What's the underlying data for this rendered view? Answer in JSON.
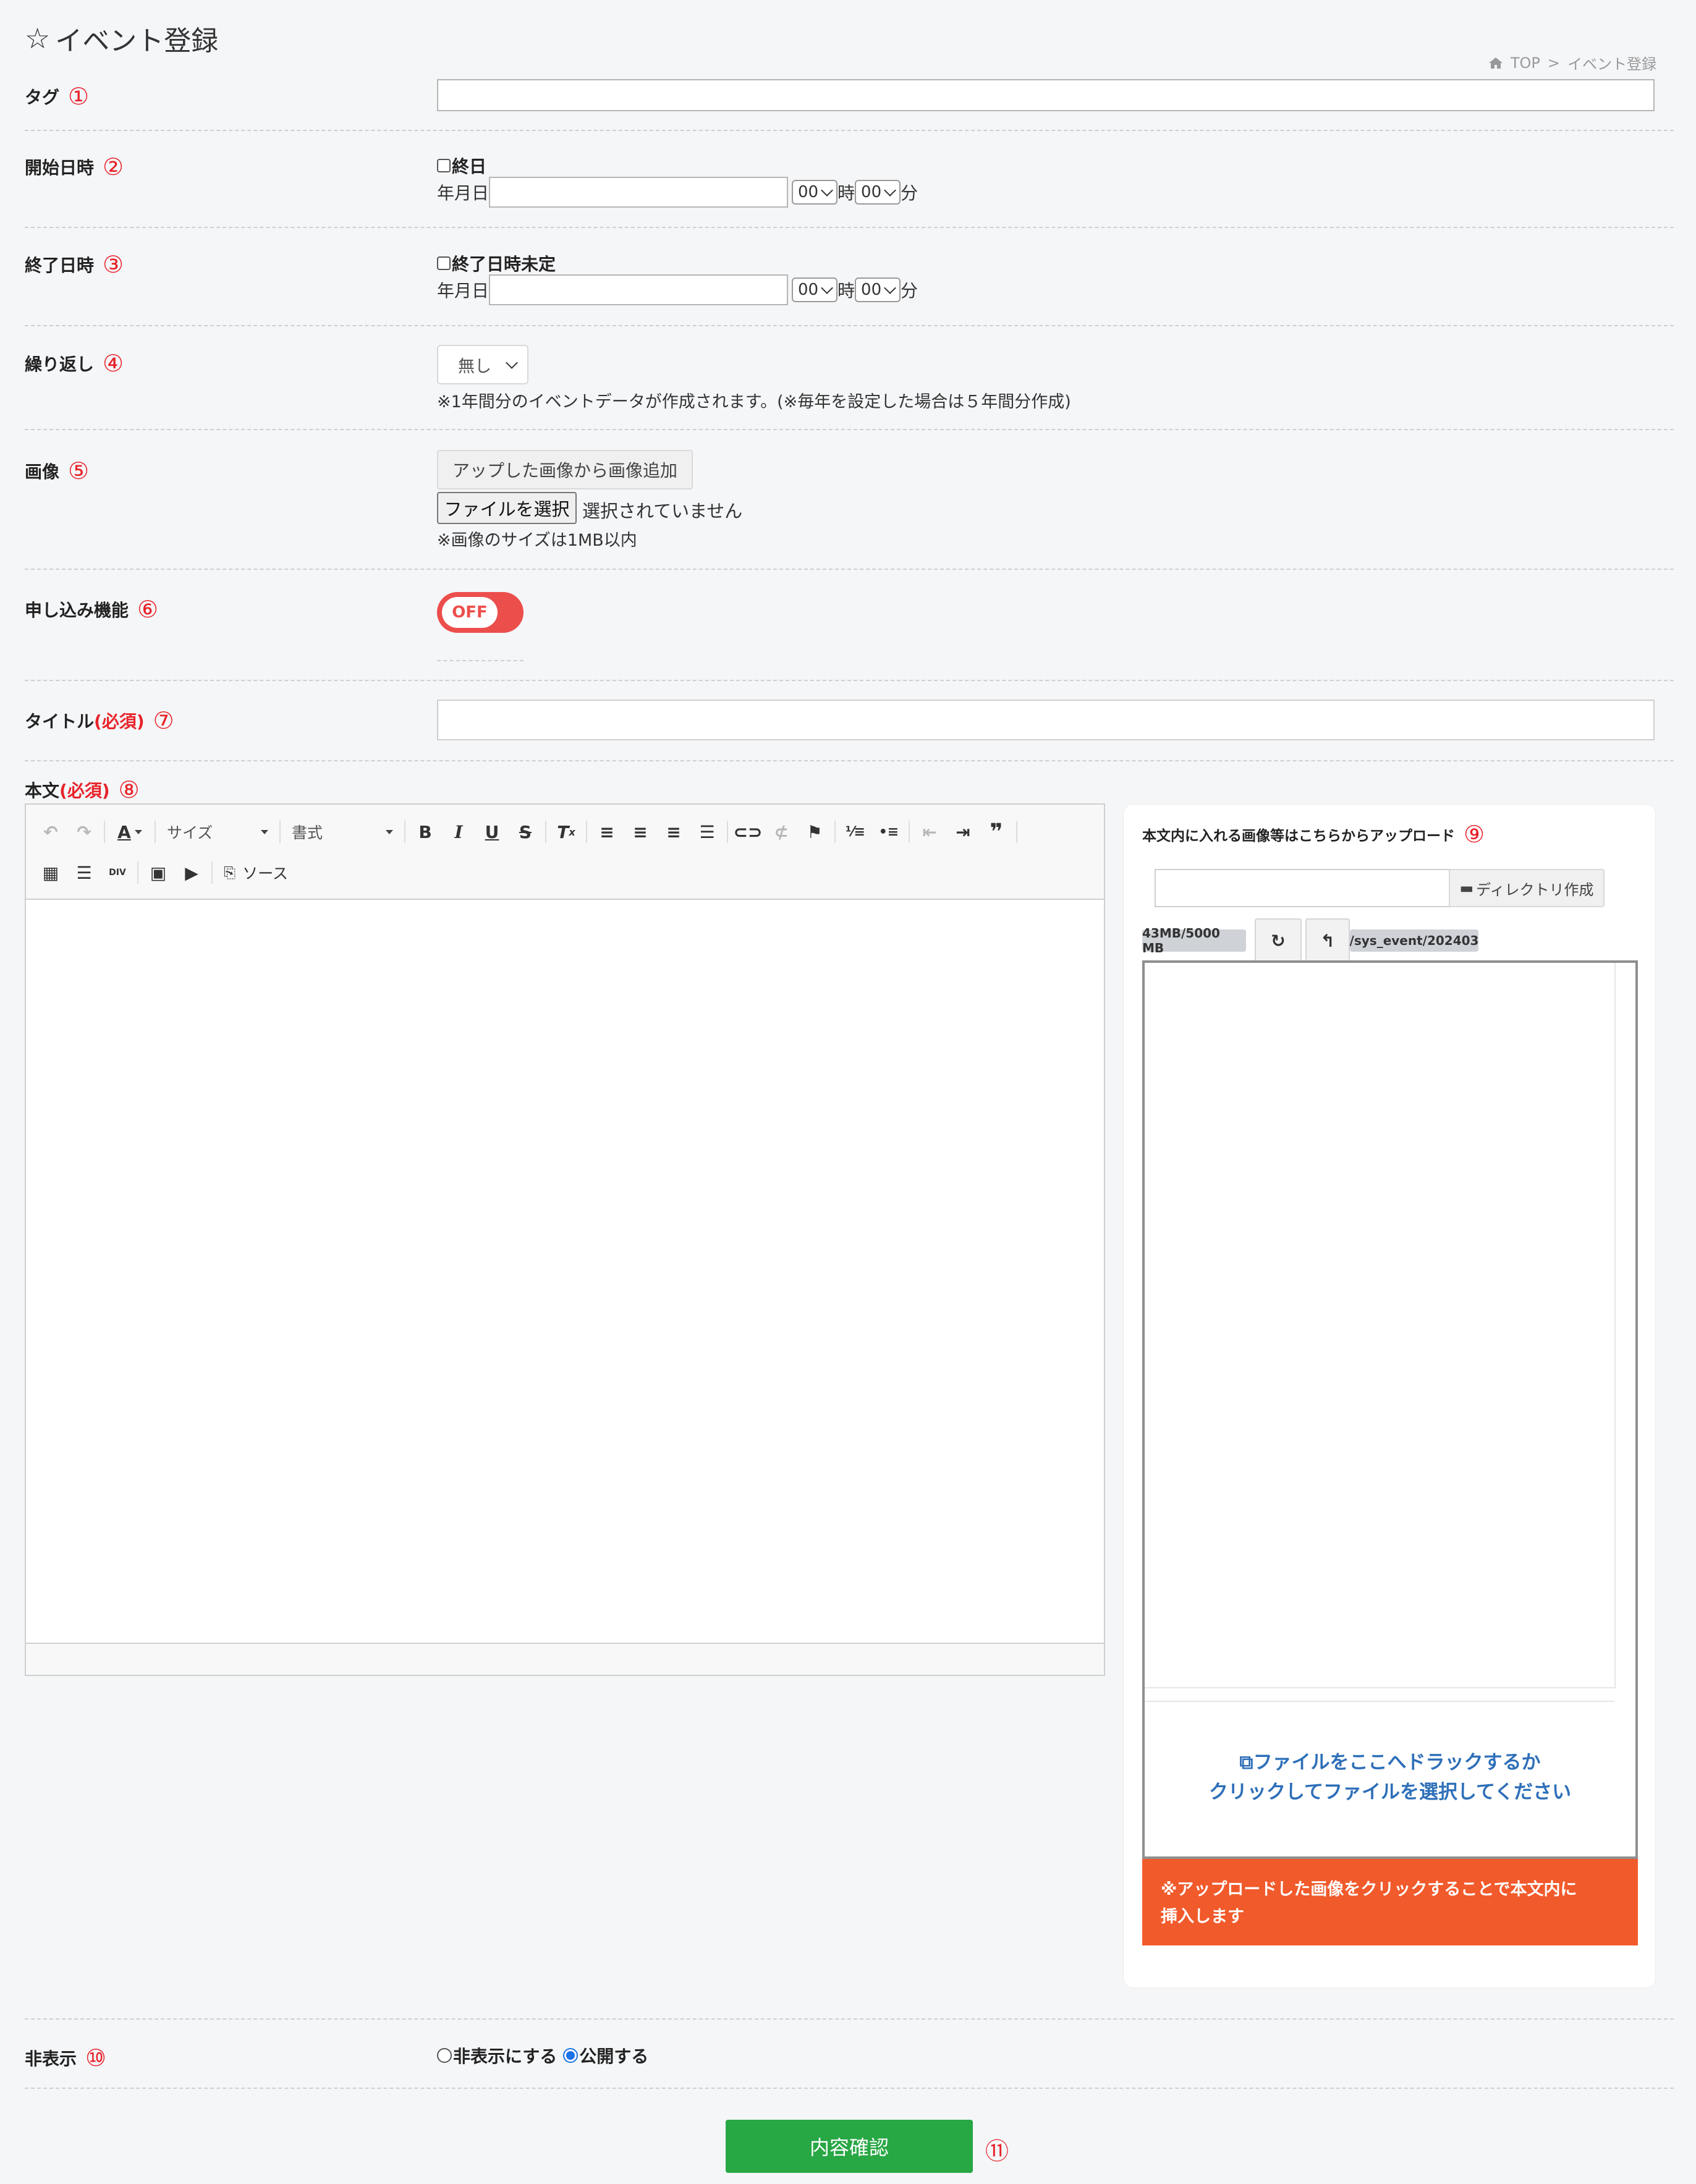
{
  "page": {
    "title": "イベント登録",
    "star": "☆",
    "breadcrumb": {
      "home": "TOP",
      "separator": ">",
      "current": "イベント登録"
    }
  },
  "markers": [
    "①",
    "②",
    "③",
    "④",
    "⑤",
    "⑥",
    "⑦",
    "⑧",
    "⑨",
    "⑩",
    "⑪"
  ],
  "fields": {
    "tag": {
      "label": "タグ",
      "value": ""
    },
    "start": {
      "label": "開始日時",
      "allday_label": "終日",
      "date_label": "年月日",
      "hour": "00",
      "hour_unit": "時",
      "minute": "00",
      "minute_unit": "分"
    },
    "end": {
      "label": "終了日時",
      "undecided_label": "終了日時未定",
      "date_label": "年月日",
      "hour": "00",
      "hour_unit": "時",
      "minute": "00",
      "minute_unit": "分"
    },
    "repeat": {
      "label": "繰り返し",
      "selected": "無し",
      "note": "※1年間分のイベントデータが作成されます。(※毎年を設定した場合は５年間分作成)"
    },
    "image": {
      "label": "画像",
      "add_from_uploaded": "アップした画像から画像追加",
      "choose_file": "ファイルを選択",
      "no_file": "選択されていません",
      "note": "※画像のサイズは1MB以内"
    },
    "application": {
      "label": "申し込み機能",
      "toggle": "OFF"
    },
    "title": {
      "label": "タイトル",
      "required": "(必須)",
      "value": ""
    },
    "body": {
      "label": "本文",
      "required": "(必須)",
      "toolbar": {
        "size_combo": "サイズ",
        "format_combo": "書式",
        "source": "ソース"
      }
    },
    "hidden": {
      "label": "非表示",
      "option_hide": "非表示にする",
      "option_public": "公開する",
      "selected": "公開する"
    }
  },
  "upload_panel": {
    "heading": "本文内に入れる画像等はこちらからアップロード",
    "dir_input": "",
    "mkdir_button": "ディレクトリ作成",
    "usage": "43MB/5000 MB",
    "path": "/sys_event/202403",
    "drop_line1": "ファイルをここへドラックするか",
    "drop_line2": "クリックしてファイルを選択してください",
    "notice_line1": "※アップロードした画像をクリックすることで本文内に",
    "notice_line2": "挿入します"
  },
  "submit": {
    "label": "内容確認"
  },
  "colors": {
    "accent_red": "#e8232a",
    "toggle": "#ec4e4b",
    "notice": "#f15a2b",
    "submit": "#28a745",
    "link": "#2e6fb8"
  }
}
